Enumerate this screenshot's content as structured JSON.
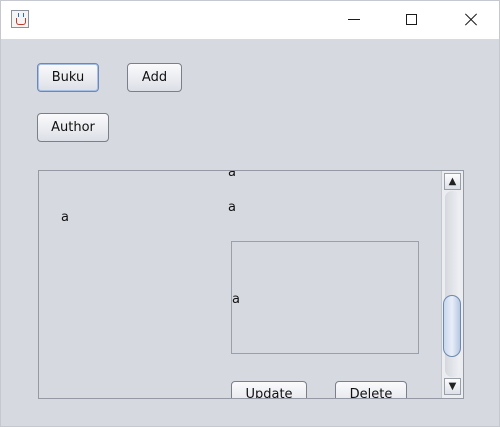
{
  "window": {
    "icon": "java-cup-icon",
    "controls": {
      "minimize_icon": "minimize-icon",
      "maximize_icon": "maximize-icon",
      "close_icon": "close-icon"
    }
  },
  "toolbar": {
    "buku_label": "Buku",
    "add_label": "Add",
    "author_label": "Author"
  },
  "panel": {
    "labels": [
      "a",
      "a",
      "a",
      "a"
    ],
    "update_label": "Update",
    "delete_label": "Delete"
  },
  "scrollbar": {
    "up_icon": "scroll-up-arrow-icon",
    "down_icon": "scroll-down-arrow-icon",
    "up_glyph": "▲",
    "down_glyph": "▼",
    "position_fraction": 0.67
  },
  "colors": {
    "window_background": "#d6d9e0",
    "titlebar_background": "#ffffff",
    "focus_border": "#6a89b8",
    "thumb_accent": "#c9d8ee"
  }
}
